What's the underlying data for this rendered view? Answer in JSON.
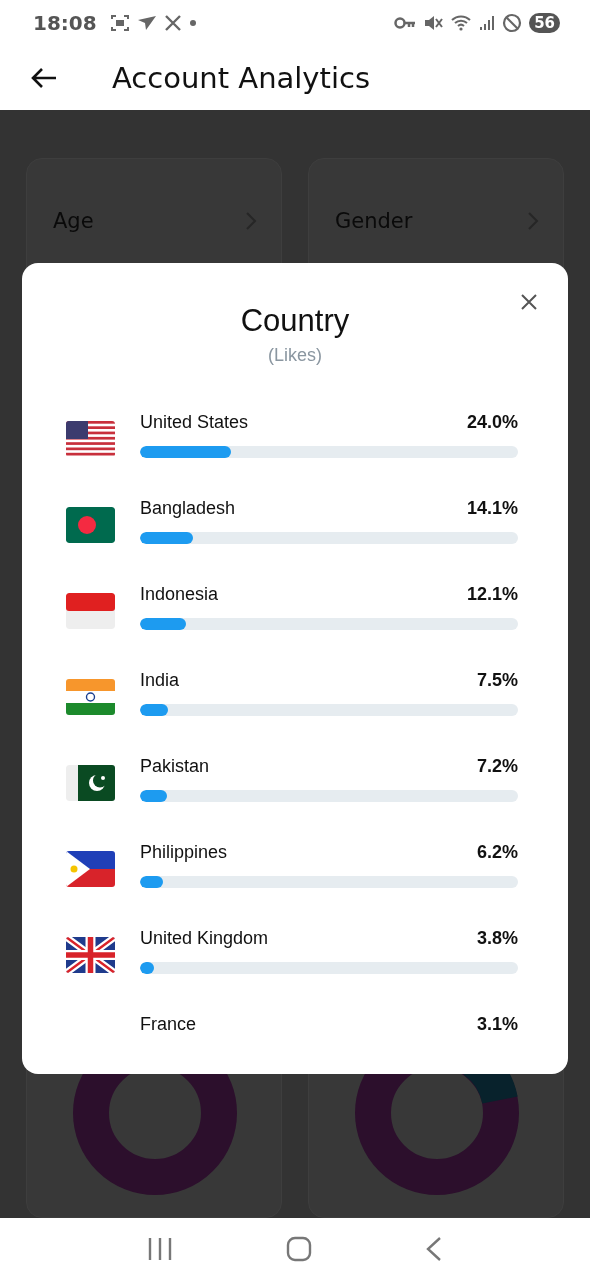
{
  "status_bar": {
    "time": "18:08",
    "battery": "56"
  },
  "app_bar": {
    "title": "Account Analytics"
  },
  "background_cards": [
    {
      "title": "Age"
    },
    {
      "title": "Gender"
    }
  ],
  "dialog": {
    "title": "Country",
    "subtitle": "(Likes)",
    "countries": [
      {
        "name": "United States",
        "value": "24.0%",
        "level": 0.24,
        "kind": "us"
      },
      {
        "name": "Bangladesh",
        "value": "14.1%",
        "level": 0.141,
        "kind": "bd"
      },
      {
        "name": "Indonesia",
        "value": "12.1%",
        "level": 0.121,
        "kind": "id"
      },
      {
        "name": "India",
        "value": "7.5%",
        "level": 0.075,
        "kind": "in"
      },
      {
        "name": "Pakistan",
        "value": "7.2%",
        "level": 0.072,
        "kind": "pk"
      },
      {
        "name": "Philippines",
        "value": "6.2%",
        "level": 0.062,
        "kind": "ph"
      },
      {
        "name": "United Kingdom",
        "value": "3.8%",
        "level": 0.038,
        "kind": "gb"
      },
      {
        "name": "France",
        "value": "3.1%"
      }
    ]
  }
}
